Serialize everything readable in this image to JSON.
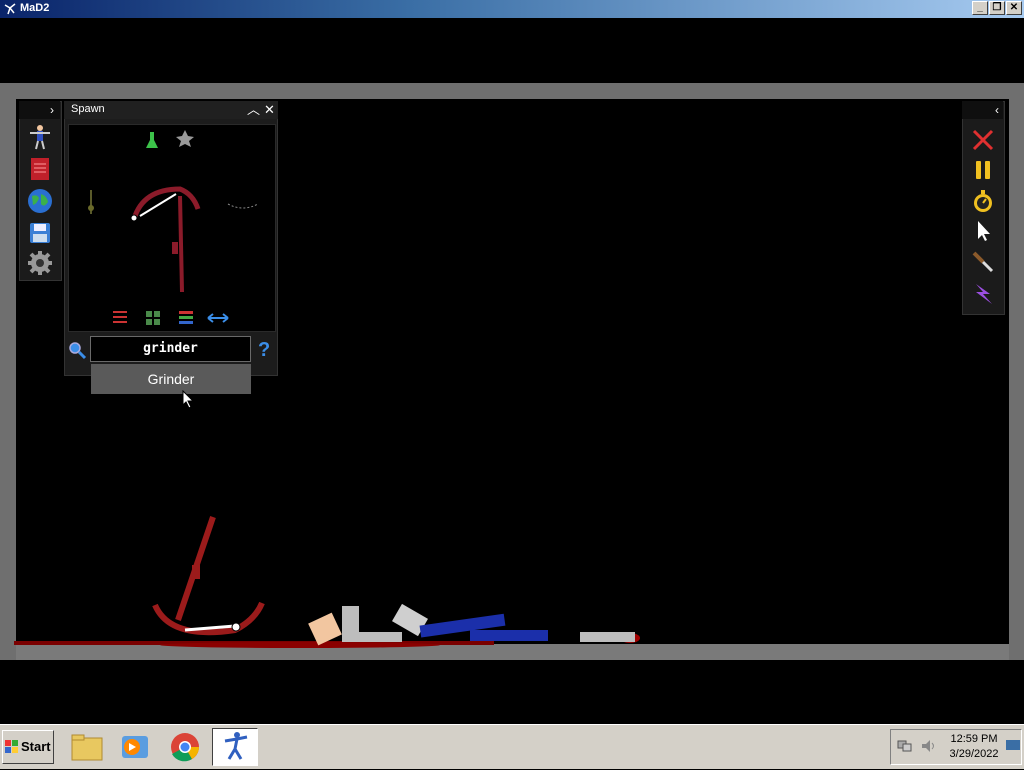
{
  "window": {
    "title": "MaD2",
    "minimize": "_",
    "restore": "❐",
    "close": "✕"
  },
  "spawn_panel": {
    "title": "Spawn",
    "collapse": "︿",
    "close": "✕",
    "search_value": "grinder",
    "help": "?",
    "suggestion": "Grinder"
  },
  "left_toolbar": {
    "toggle": "›"
  },
  "right_toolbar": {
    "toggle": "‹"
  },
  "taskbar": {
    "start_label": "Start",
    "time": "12:59 PM",
    "date": "3/29/2022"
  },
  "colors": {
    "accent_red": "#9b1b1b",
    "blood": "#8b0000",
    "search_blue": "#3b8ee8"
  }
}
